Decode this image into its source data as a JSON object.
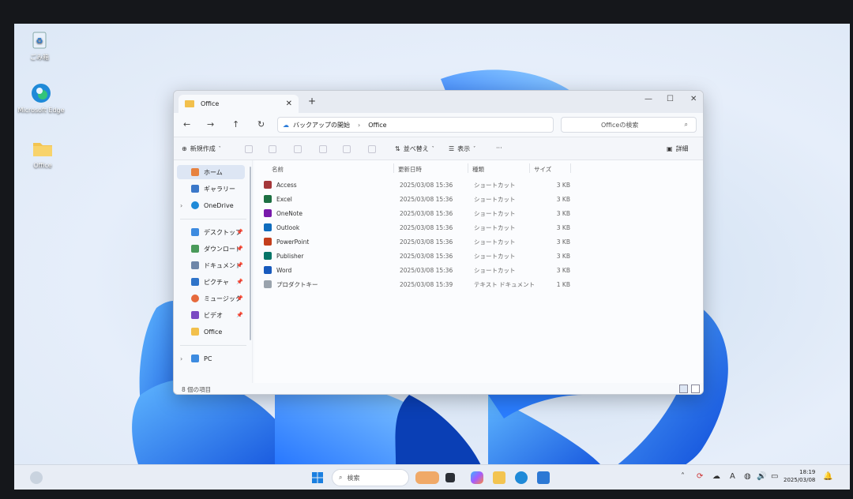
{
  "desktop": {
    "icons": [
      {
        "label": "ごみ箱",
        "icon": "recycle-bin-icon"
      },
      {
        "label": "Microsoft Edge",
        "icon": "edge-icon"
      },
      {
        "label": "Office",
        "icon": "folder-icon"
      }
    ]
  },
  "explorer": {
    "tab_title": "Office",
    "breadcrumb": [
      "バックアップの開始",
      "Office"
    ],
    "search_placeholder": "Officeの検索",
    "toolbar": {
      "new_label": "新規作成",
      "sort_label": "並べ替え",
      "view_label": "表示",
      "more_label": "···",
      "details_label": "詳細"
    },
    "nav": {
      "home": "ホーム",
      "gallery": "ギャラリー",
      "onedrive": "OneDrive",
      "desktop": "デスクトップ",
      "downloads": "ダウンロード",
      "documents": "ドキュメント",
      "pictures": "ピクチャ",
      "music": "ミュージック",
      "videos": "ビデオ",
      "office": "Office",
      "pc": "PC"
    },
    "columns": {
      "name": "名前",
      "date": "更新日時",
      "type": "種類",
      "size": "サイズ"
    },
    "files": [
      {
        "name": "Access",
        "date": "2025/03/08 15:36",
        "type": "ショートカット",
        "size": "3 KB",
        "color": "#a4373a"
      },
      {
        "name": "Excel",
        "date": "2025/03/08 15:36",
        "type": "ショートカット",
        "size": "3 KB",
        "color": "#1d6f42"
      },
      {
        "name": "OneNote",
        "date": "2025/03/08 15:36",
        "type": "ショートカット",
        "size": "3 KB",
        "color": "#7719aa"
      },
      {
        "name": "Outlook",
        "date": "2025/03/08 15:36",
        "type": "ショートカット",
        "size": "3 KB",
        "color": "#0f6cbd"
      },
      {
        "name": "PowerPoint",
        "date": "2025/03/08 15:36",
        "type": "ショートカット",
        "size": "3 KB",
        "color": "#c43e1c"
      },
      {
        "name": "Publisher",
        "date": "2025/03/08 15:36",
        "type": "ショートカット",
        "size": "3 KB",
        "color": "#077568"
      },
      {
        "name": "Word",
        "date": "2025/03/08 15:36",
        "type": "ショートカット",
        "size": "3 KB",
        "color": "#185abd"
      },
      {
        "name": "プロダクトキー",
        "date": "2025/03/08 15:39",
        "type": "テキスト ドキュメント",
        "size": "1 KB",
        "color": "#9aa3ad"
      }
    ],
    "status": "8 個の項目"
  },
  "taskbar": {
    "search_label": "検索",
    "time": "18:19",
    "date": "2025/03/08",
    "ime": "A"
  }
}
